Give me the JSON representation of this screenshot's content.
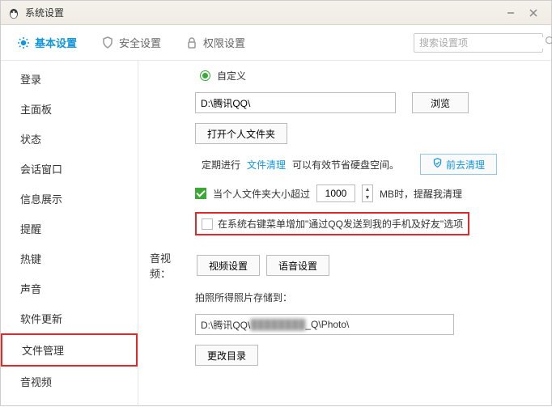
{
  "titlebar": {
    "title": "系统设置"
  },
  "tabs": {
    "basic": "基本设置",
    "security": "安全设置",
    "privacy": "权限设置"
  },
  "search": {
    "placeholder": "搜索设置项"
  },
  "sidebar": {
    "items": [
      {
        "label": "登录"
      },
      {
        "label": "主面板"
      },
      {
        "label": "状态"
      },
      {
        "label": "会话窗口"
      },
      {
        "label": "信息展示"
      },
      {
        "label": "提醒"
      },
      {
        "label": "热键"
      },
      {
        "label": "声音"
      },
      {
        "label": "软件更新"
      },
      {
        "label": "文件管理"
      },
      {
        "label": "音视频"
      }
    ]
  },
  "content": {
    "custom_label": "自定义",
    "path_value": "D:\\腾讯QQ\\",
    "browse_btn": "浏览",
    "open_folder_btn": "打开个人文件夹",
    "cleanup_prefix": "定期进行",
    "cleanup_link": "文件清理",
    "cleanup_suffix": "可以有效节省硬盘空间。",
    "go_clean_btn": "前去清理",
    "size_warn_prefix": "当个人文件夹大小超过",
    "size_value": "1000",
    "size_warn_suffix": "MB时，提醒我清理",
    "context_menu_option": "在系统右键菜单增加\"通过QQ发送到我的手机及好友\"选项",
    "av_section": "音视频：",
    "video_settings_btn": "视频设置",
    "voice_settings_btn": "语音设置",
    "photo_label": "拍照所得照片存储到：",
    "photo_path_prefix": "D:\\腾讯QQ\\",
    "photo_path_blur": "████████",
    "photo_path_suffix": "_Q\\Photo\\",
    "change_dir_btn": "更改目录"
  }
}
